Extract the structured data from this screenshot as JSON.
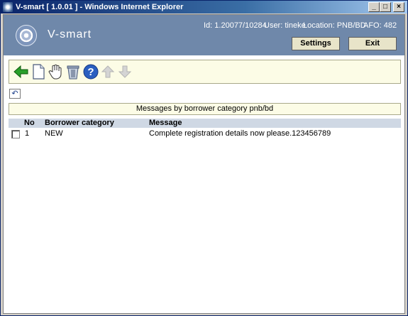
{
  "window": {
    "title": "V-smart [ 1.0.01 ] - Windows Internet Explorer",
    "controls": {
      "minimize": "_",
      "maximize": "□",
      "close": "×"
    }
  },
  "header": {
    "brand": "V-smart",
    "id_text": "Id: 1.20077/10284",
    "user_text": "User: tineke",
    "location_text": "Location: PNB/BD",
    "afo_text": "AFO: 482",
    "settings_label": "Settings",
    "exit_label": "Exit"
  },
  "toolbar": {
    "icons": [
      "back-arrow-icon",
      "new-document-icon",
      "select-hand-icon",
      "delete-trash-icon",
      "help-icon",
      "move-up-icon",
      "move-down-icon"
    ]
  },
  "undo_symbol": "↶",
  "caption": "Messages by borrower category pnb/bd",
  "table": {
    "columns": [
      "No",
      "Borrower category",
      "Message"
    ],
    "rows": [
      {
        "no": "1",
        "category": "NEW",
        "message": "Complete registration details now please.123456789"
      }
    ]
  },
  "colors": {
    "header_bg": "#6f88aa",
    "toolbar_bg": "#fcfce6",
    "table_header_bg": "#cfd8e4",
    "titlebar_start": "#0a246a"
  }
}
